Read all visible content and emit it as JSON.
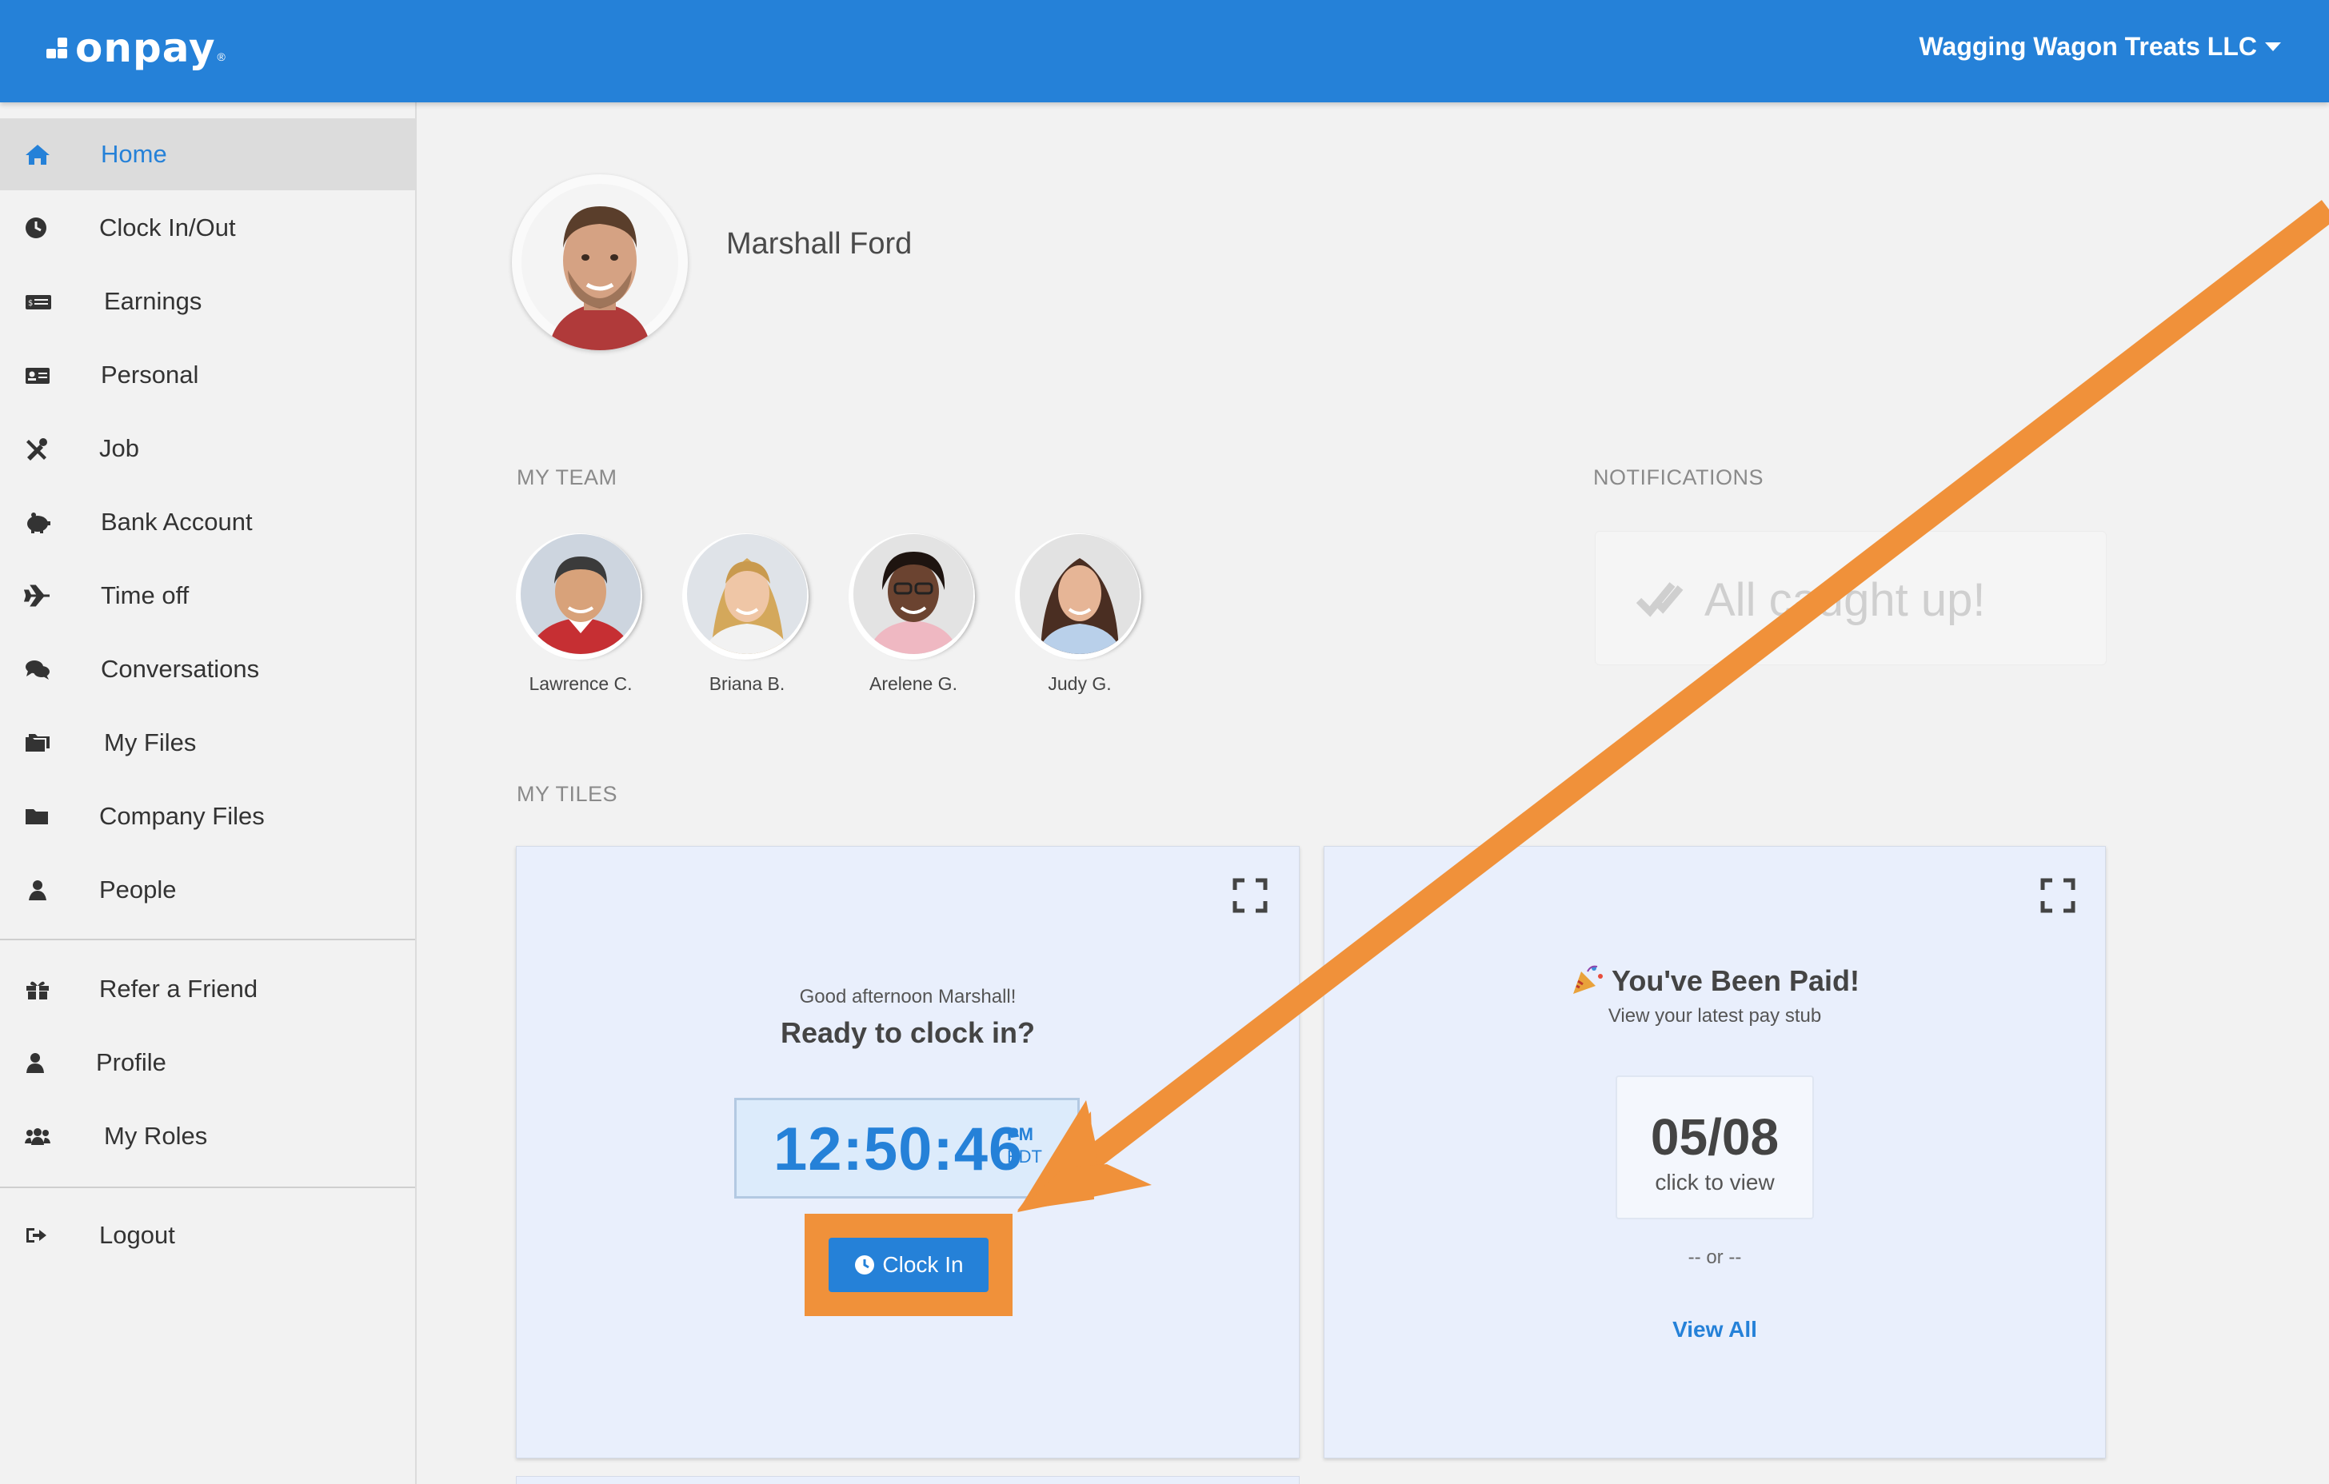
{
  "header": {
    "logo_text": "onpay",
    "logo_mark": "®",
    "company_name": "Wagging Wagon Treats LLC"
  },
  "sidebar": {
    "items": [
      {
        "label": "Home",
        "icon": "home-icon",
        "active": true
      },
      {
        "label": "Clock In/Out",
        "icon": "clock-icon"
      },
      {
        "label": "Earnings",
        "icon": "money-icon"
      },
      {
        "label": "Personal",
        "icon": "id-card-icon"
      },
      {
        "label": "Job",
        "icon": "tools-icon"
      },
      {
        "label": "Bank Account",
        "icon": "piggy-bank-icon"
      },
      {
        "label": "Time off",
        "icon": "plane-icon"
      },
      {
        "label": "Conversations",
        "icon": "chat-icon"
      },
      {
        "label": "My Files",
        "icon": "files-icon"
      },
      {
        "label": "Company Files",
        "icon": "folder-icon"
      },
      {
        "label": "People",
        "icon": "people-icon"
      },
      {
        "label": "Refer a Friend",
        "icon": "gift-icon"
      },
      {
        "label": "Profile",
        "icon": "user-icon"
      },
      {
        "label": "My Roles",
        "icon": "users-icon"
      },
      {
        "label": "Logout",
        "icon": "logout-icon"
      }
    ]
  },
  "profile": {
    "name": "Marshall Ford"
  },
  "team": {
    "heading": "MY TEAM",
    "members": [
      {
        "name": "Lawrence C."
      },
      {
        "name": "Briana B."
      },
      {
        "name": "Arelene G."
      },
      {
        "name": "Judy G."
      }
    ]
  },
  "notifications": {
    "heading": "NOTIFICATIONS",
    "message": "All caught up!"
  },
  "tiles": {
    "heading": "MY TILES",
    "clock": {
      "greeting": "Good afternoon Marshall!",
      "prompt": "Ready to clock in?",
      "time": "12:50:46",
      "ampm": "PM",
      "timezone": "EDT",
      "button_label": "Clock In"
    },
    "pay": {
      "title": "You've Been Paid!",
      "subtitle": "View your latest pay stub",
      "date": "05/08",
      "date_hint": "click to view",
      "separator": "-- or --",
      "view_all": "View All"
    }
  },
  "colors": {
    "brand_blue": "#2581d8",
    "highlight_orange": "#f0913a"
  }
}
